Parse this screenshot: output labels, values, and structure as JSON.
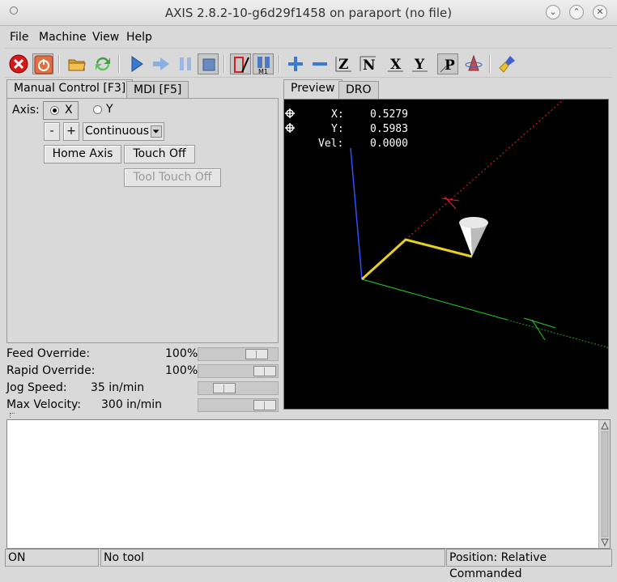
{
  "window": {
    "title": "AXIS 2.8.2-10-g6d29f1458 on paraport (no file)"
  },
  "menu": {
    "file": "File",
    "machine": "Machine",
    "view": "View",
    "help": "Help"
  },
  "tabs": {
    "manual": "Manual Control [F3]",
    "mdi": "MDI [F5]",
    "preview": "Preview",
    "dro": "DRO"
  },
  "manual": {
    "axis_label": "Axis:",
    "axis_x": "X",
    "axis_y": "Y",
    "jog_minus": "-",
    "jog_plus": "+",
    "jog_increment": "Continuous",
    "home_axis": "Home Axis",
    "touch_off": "Touch Off",
    "tool_touch_off": "Tool Touch Off"
  },
  "overrides": {
    "feed_label": "Feed Override:",
    "feed_value": "100",
    "rapid_label": "Rapid Override:",
    "rapid_value": "100",
    "percent": "%",
    "jog_label": "Jog Speed:",
    "jog_value": "35 in/min",
    "maxvel_label": "Max Velocity:",
    "maxvel_value": "300 in/min"
  },
  "dro": {
    "x_label": "X:",
    "x_value": "0.5279",
    "y_label": "Y:",
    "y_value": "0.5983",
    "vel_label": "Vel:",
    "vel_value": "0.0000"
  },
  "status": {
    "machine": "ON",
    "tool": "No tool",
    "position": "Position: Relative Commanded"
  },
  "colors": {
    "x_axis": "#ff2020",
    "y_axis": "#20d020",
    "z_axis": "#3050ff",
    "toolpath": "#e8d020"
  }
}
